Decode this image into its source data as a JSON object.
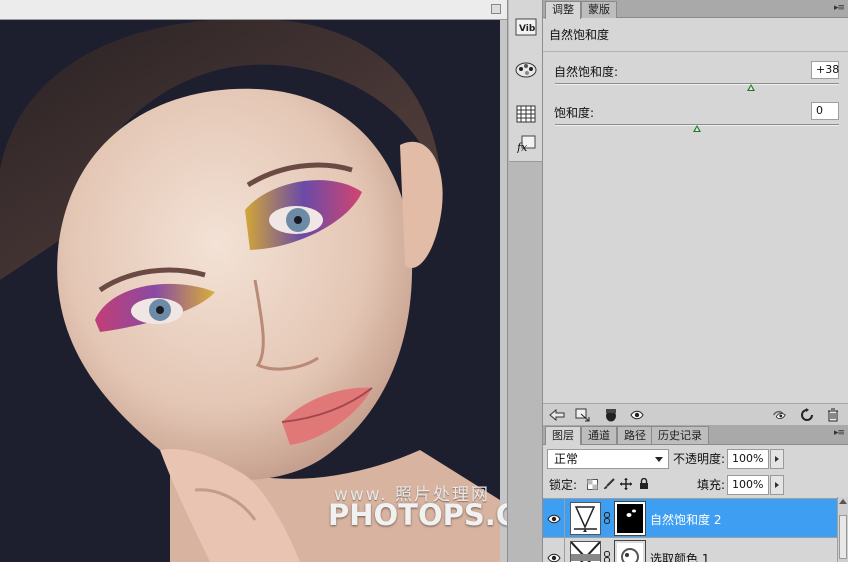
{
  "adjustments_panel": {
    "tabs": [
      {
        "label": "调整",
        "active": true
      },
      {
        "label": "蒙版",
        "active": false
      }
    ],
    "title": "自然饱和度",
    "sliders": [
      {
        "label": "自然饱和度:",
        "value": "+38",
        "level_percent": 69
      },
      {
        "label": "饱和度:",
        "value": "0",
        "level_percent": 50
      }
    ]
  },
  "tool_strip": {
    "icons": [
      "vib-adjustment-icon",
      "color-palette-icon",
      "swatches-grid-icon",
      "fx-styles-icon"
    ]
  },
  "adjustment_footer_icons": [
    "return-arrow-icon",
    "clip-layer-icon",
    "mask-drop-icon",
    "visibility-eye-icon",
    "view-previous-icon",
    "reset-icon",
    "delete-icon"
  ],
  "layers_panel": {
    "tabs": [
      {
        "label": "图层",
        "active": true
      },
      {
        "label": "通道",
        "active": false
      },
      {
        "label": "路径",
        "active": false
      },
      {
        "label": "历史记录",
        "active": false
      }
    ],
    "blend_mode": "正常",
    "opacity_label": "不透明度:",
    "opacity_value": "100%",
    "lock_label": "锁定:",
    "fill_label": "填充:",
    "fill_value": "100%",
    "layers": [
      {
        "name": "自然饱和度 2",
        "selected": true,
        "visible": true
      },
      {
        "name": "选取颜色 1",
        "selected": false,
        "visible": true
      }
    ]
  },
  "watermark": {
    "top_text": "www.   照片处理网",
    "main_text": "PHOTOPS.COM"
  },
  "colors": {
    "selection_blue": "#3e9ef2",
    "panel_grey": "#d6d6d6",
    "slider_thumb_green": "#1d7a25",
    "canvas_background": "#1d1f2e"
  }
}
